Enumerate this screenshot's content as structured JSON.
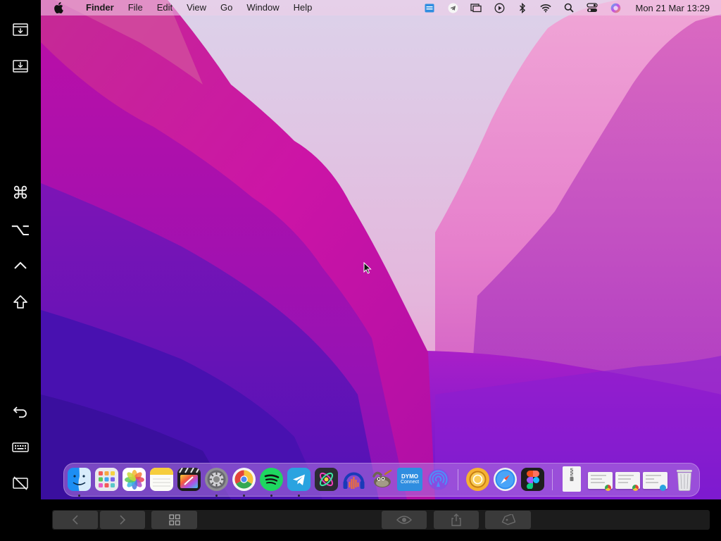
{
  "menubar": {
    "app_name": "Finder",
    "items": [
      "File",
      "Edit",
      "View",
      "Go",
      "Window",
      "Help"
    ],
    "clock": "Mon 21 Mar  13:29",
    "status_icons": [
      "dymo-icon",
      "telegram-icon",
      "screen-mirroring-icon",
      "play-icon",
      "bluetooth-icon",
      "wifi-icon",
      "search-icon",
      "control-center-icon",
      "siri-icon"
    ]
  },
  "sidebar": {
    "buttons": [
      "show-menu-bar",
      "show-dock",
      "command",
      "option",
      "control",
      "shift",
      "undo",
      "keyboard",
      "disconnect"
    ]
  },
  "sidebar_glyphs": {
    "command": "⌘",
    "option": "⌥"
  },
  "dock": {
    "apps": [
      {
        "name": "Finder",
        "icon": "finder-icon",
        "running": true
      },
      {
        "name": "Launchpad",
        "icon": "launchpad-icon",
        "running": false
      },
      {
        "name": "Photos",
        "icon": "photos-icon",
        "running": false
      },
      {
        "name": "Notes",
        "icon": "notes-icon",
        "running": false
      },
      {
        "name": "Final Cut Pro",
        "icon": "final-cut-icon",
        "running": false
      },
      {
        "name": "System Preferences",
        "icon": "settings-icon",
        "running": true
      },
      {
        "name": "Google Chrome",
        "icon": "chrome-icon",
        "running": true
      },
      {
        "name": "Spotify",
        "icon": "spotify-icon",
        "running": true
      },
      {
        "name": "Telegram",
        "icon": "telegram-icon",
        "running": true
      },
      {
        "name": "Motion",
        "icon": "motion-icon",
        "running": false
      },
      {
        "name": "Audacity",
        "icon": "audacity-icon",
        "running": false
      },
      {
        "name": "GIMP",
        "icon": "gimp-icon",
        "running": false
      },
      {
        "name": "DYMO Connect",
        "icon": "dymo-connect-icon",
        "running": false
      },
      {
        "name": "AirDrop",
        "icon": "airdrop-icon",
        "running": false
      },
      {
        "name": "Amphetamine",
        "icon": "amphetamine-icon",
        "running": false
      },
      {
        "name": "Safari",
        "icon": "safari-icon",
        "running": false
      },
      {
        "name": "Figma",
        "icon": "figma-icon",
        "running": false
      }
    ],
    "dymo_label": [
      "DYMO",
      "Connect"
    ],
    "documents": [
      "zip-archive",
      "chrome-document-1",
      "chrome-document-2",
      "telegram-document"
    ],
    "trash": "trash-icon"
  },
  "bottombar": {
    "buttons": [
      "back",
      "forward",
      "grid-view",
      "quick-look",
      "share",
      "tag"
    ]
  },
  "colors": {
    "menubar_bg": "#eecee8",
    "dock_bg": "#af78e1",
    "wallpaper_top": "#e3c7e8",
    "wallpaper_mid": "#c20d9f",
    "wallpaper_bottom": "#4a10b8"
  }
}
